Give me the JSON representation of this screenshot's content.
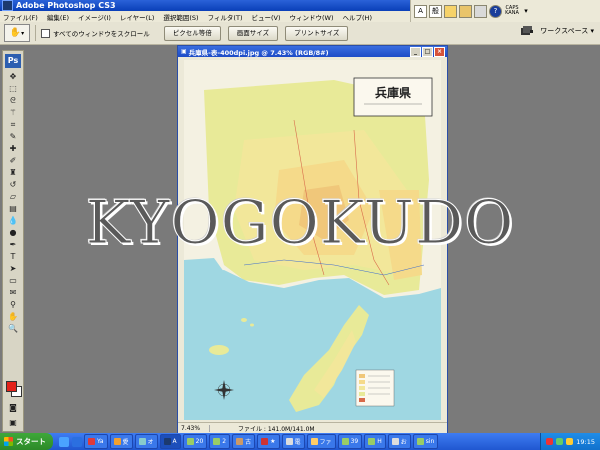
{
  "app": {
    "title": "Adobe Photoshop CS3",
    "menus": [
      "ファイル(F)",
      "編集(E)",
      "イメージ(I)",
      "レイヤー(L)",
      "選択範囲(S)",
      "フィルタ(T)",
      "ビュー(V)",
      "ウィンドウ(W)",
      "ヘルプ(H)"
    ]
  },
  "ime": {
    "mode": "A",
    "mode2": "般",
    "caps": "CAPS",
    "kana": "KANA"
  },
  "options_bar": {
    "scroll_all_label": "すべてのウィンドウをスクロール",
    "buttons": [
      "ピクセル等倍",
      "画面サイズ",
      "プリントサイズ"
    ],
    "workspace_label": "ワークスペース ▾"
  },
  "toolbox": {
    "logo": "Ps",
    "foreground_color": "#e3231b",
    "background_color": "#ffffff"
  },
  "document": {
    "title": "兵庫県-表-400dpi.jpg @ 7.43% (RGB/8#)",
    "map_title": "兵庫県",
    "zoom": "7.43%",
    "file_info": "ファイル : 141.0M/141.0M"
  },
  "watermark": "KYOGOKUDO",
  "taskbar": {
    "start_label": "スタート",
    "buttons": [
      "Ya",
      "愛",
      "オ",
      "A",
      "20",
      "2",
      "古",
      "★",
      "電",
      "ファ",
      "39",
      "H",
      "お",
      "sin"
    ],
    "clock": "19:15"
  },
  "colors": {
    "title_blue": "#0a3fb8",
    "taskbar_blue": "#2057d0",
    "start_green": "#3fa83a",
    "sea": "#9fd7e2",
    "land": "#e8ea98"
  }
}
